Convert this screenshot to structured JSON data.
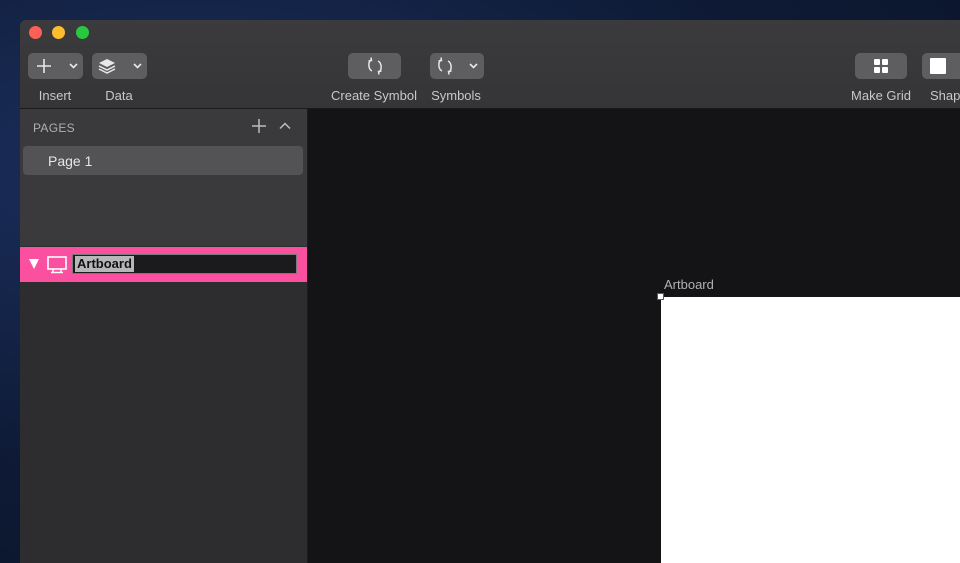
{
  "toolbar": {
    "insert_label": "Insert",
    "data_label": "Data",
    "create_symbol_label": "Create Symbol",
    "symbols_label": "Symbols",
    "make_grid_label": "Make Grid",
    "shape_label": "Shap"
  },
  "pages": {
    "header": "PAGES",
    "items": [
      {
        "label": "Page 1"
      }
    ]
  },
  "layers": {
    "items": [
      {
        "label": "Artboard",
        "type": "artboard",
        "editing": true
      }
    ]
  },
  "canvas": {
    "artboard_label": "Artboard"
  },
  "colors": {
    "selection_pink": "#fb4f9f",
    "canvas_bg": "#141416",
    "sidebar_bg": "#2d2d2f",
    "close": "#fe5f57",
    "minimize": "#febc2e",
    "zoom": "#28c840"
  }
}
